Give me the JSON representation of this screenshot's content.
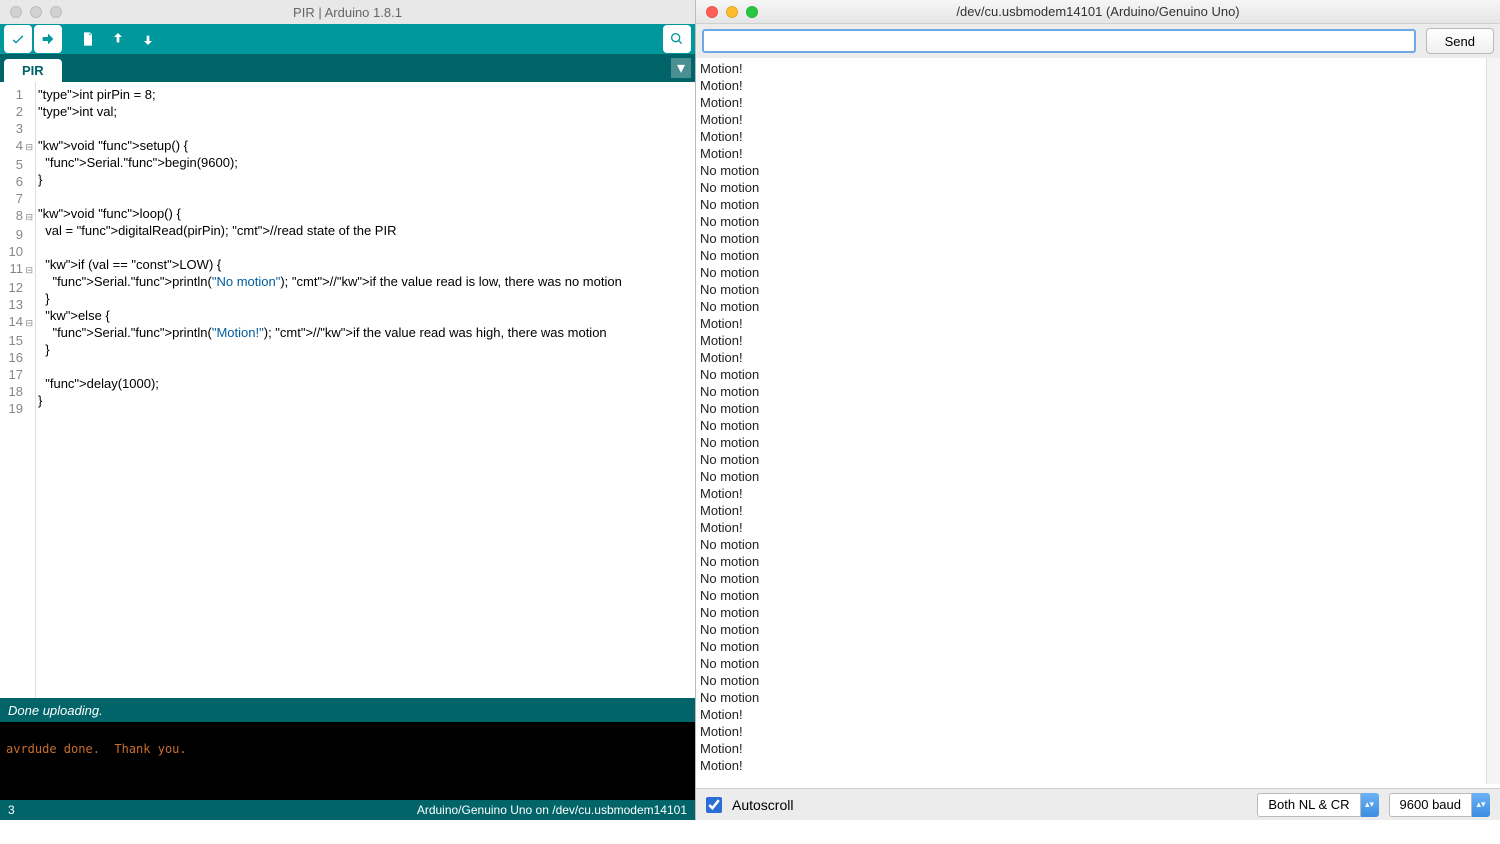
{
  "ide": {
    "title": "PIR | Arduino 1.8.1",
    "tab": "PIR",
    "status": "Done uploading.",
    "console": "avrdude done.  Thank you.",
    "footer_left": "3",
    "footer_right": "Arduino/Genuino Uno on /dev/cu.usbmodem14101",
    "code": [
      {
        "n": "1",
        "fold": "",
        "raw": "int pirPin = 8;"
      },
      {
        "n": "2",
        "fold": "",
        "raw": "int val;"
      },
      {
        "n": "3",
        "fold": "",
        "raw": ""
      },
      {
        "n": "4",
        "fold": "⊟",
        "raw": "void setup() {"
      },
      {
        "n": "5",
        "fold": "",
        "raw": "  Serial.begin(9600);"
      },
      {
        "n": "6",
        "fold": "",
        "raw": "}"
      },
      {
        "n": "7",
        "fold": "",
        "raw": ""
      },
      {
        "n": "8",
        "fold": "⊟",
        "raw": "void loop() {"
      },
      {
        "n": "9",
        "fold": "",
        "raw": "  val = digitalRead(pirPin); //read state of the PIR"
      },
      {
        "n": "10",
        "fold": "",
        "raw": ""
      },
      {
        "n": "11",
        "fold": "⊟",
        "raw": "  if (val == LOW) {"
      },
      {
        "n": "12",
        "fold": "",
        "raw": "    Serial.println(\"No motion\"); //if the value read is low, there was no motion"
      },
      {
        "n": "13",
        "fold": "",
        "raw": "  }"
      },
      {
        "n": "14",
        "fold": "⊟",
        "raw": "  else {"
      },
      {
        "n": "15",
        "fold": "",
        "raw": "    Serial.println(\"Motion!\"); //if the value read was high, there was motion"
      },
      {
        "n": "16",
        "fold": "",
        "raw": "  }"
      },
      {
        "n": "17",
        "fold": "",
        "raw": ""
      },
      {
        "n": "18",
        "fold": "",
        "raw": "  delay(1000);"
      },
      {
        "n": "19",
        "fold": "",
        "raw": "}"
      }
    ]
  },
  "sm": {
    "title": "/dev/cu.usbmodem14101 (Arduino/Genuino Uno)",
    "send": "Send",
    "input": "",
    "autoscroll": "Autoscroll",
    "line_ending": "Both NL & CR",
    "baud": "9600 baud",
    "output": [
      "Motion!",
      "Motion!",
      "Motion!",
      "Motion!",
      "Motion!",
      "Motion!",
      "No motion",
      "No motion",
      "No motion",
      "No motion",
      "No motion",
      "No motion",
      "No motion",
      "No motion",
      "No motion",
      "Motion!",
      "Motion!",
      "Motion!",
      "No motion",
      "No motion",
      "No motion",
      "No motion",
      "No motion",
      "No motion",
      "No motion",
      "Motion!",
      "Motion!",
      "Motion!",
      "No motion",
      "No motion",
      "No motion",
      "No motion",
      "No motion",
      "No motion",
      "No motion",
      "No motion",
      "No motion",
      "No motion",
      "Motion!",
      "Motion!",
      "Motion!",
      "Motion!"
    ]
  }
}
